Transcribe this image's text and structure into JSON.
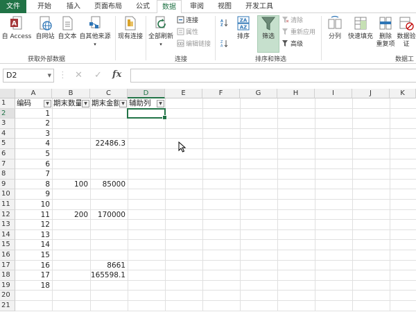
{
  "tabs": [
    {
      "label": "文件"
    },
    {
      "label": "开始"
    },
    {
      "label": "插入"
    },
    {
      "label": "页面布局"
    },
    {
      "label": "公式"
    },
    {
      "label": "数据"
    },
    {
      "label": "审阅"
    },
    {
      "label": "视图"
    },
    {
      "label": "开发工具"
    }
  ],
  "ribbon": {
    "access": "自 Access",
    "web": "自网站",
    "text": "自文本",
    "other": "自其他来源",
    "existing": "现有连接",
    "refresh_all": "全部刷新",
    "connections": "连接",
    "properties": "属性",
    "edit_links": "编辑链接",
    "sort": "排序",
    "filter": "筛选",
    "clear": "清除",
    "reapply": "重新应用",
    "advanced": "高级",
    "text_to_columns": "分列",
    "flash_fill": "快速填充",
    "remove_dup_1": "删除",
    "remove_dup_2": "重复项",
    "validation_1": "数据验",
    "validation_2": "证",
    "group_external": "获取外部数据",
    "group_connections": "连接",
    "group_sort_filter": "排序和筛选",
    "group_data_tools": "数据工"
  },
  "formula_bar": {
    "name_box": "D2",
    "fx": "fx",
    "value": ""
  },
  "columns": [
    "A",
    "B",
    "C",
    "D",
    "E",
    "F",
    "G",
    "H",
    "I",
    "J",
    "K"
  ],
  "headers": {
    "a": "编码",
    "b": "期末数量",
    "c": "期末金额",
    "d": "辅助列"
  },
  "rows": [
    {
      "n": "1"
    },
    {
      "n": "2",
      "a": "1"
    },
    {
      "n": "3",
      "a": "2"
    },
    {
      "n": "4",
      "a": "3"
    },
    {
      "n": "5",
      "a": "4",
      "c": "22486.3"
    },
    {
      "n": "6",
      "a": "5"
    },
    {
      "n": "7",
      "a": "6"
    },
    {
      "n": "8",
      "a": "7"
    },
    {
      "n": "9",
      "a": "8",
      "b": "100",
      "c": "85000"
    },
    {
      "n": "10",
      "a": "9"
    },
    {
      "n": "11",
      "a": "10"
    },
    {
      "n": "12",
      "a": "11",
      "b": "200",
      "c": "170000"
    },
    {
      "n": "13",
      "a": "12"
    },
    {
      "n": "14",
      "a": "13"
    },
    {
      "n": "15",
      "a": "14"
    },
    {
      "n": "16",
      "a": "15"
    },
    {
      "n": "17",
      "a": "16",
      "c": "8661"
    },
    {
      "n": "18",
      "a": "17",
      "c": "165598.1"
    },
    {
      "n": "19",
      "a": "18"
    },
    {
      "n": "20"
    },
    {
      "n": "21"
    }
  ],
  "colors": {
    "accent": "#217346",
    "filter_active": "#c6e0cd"
  }
}
